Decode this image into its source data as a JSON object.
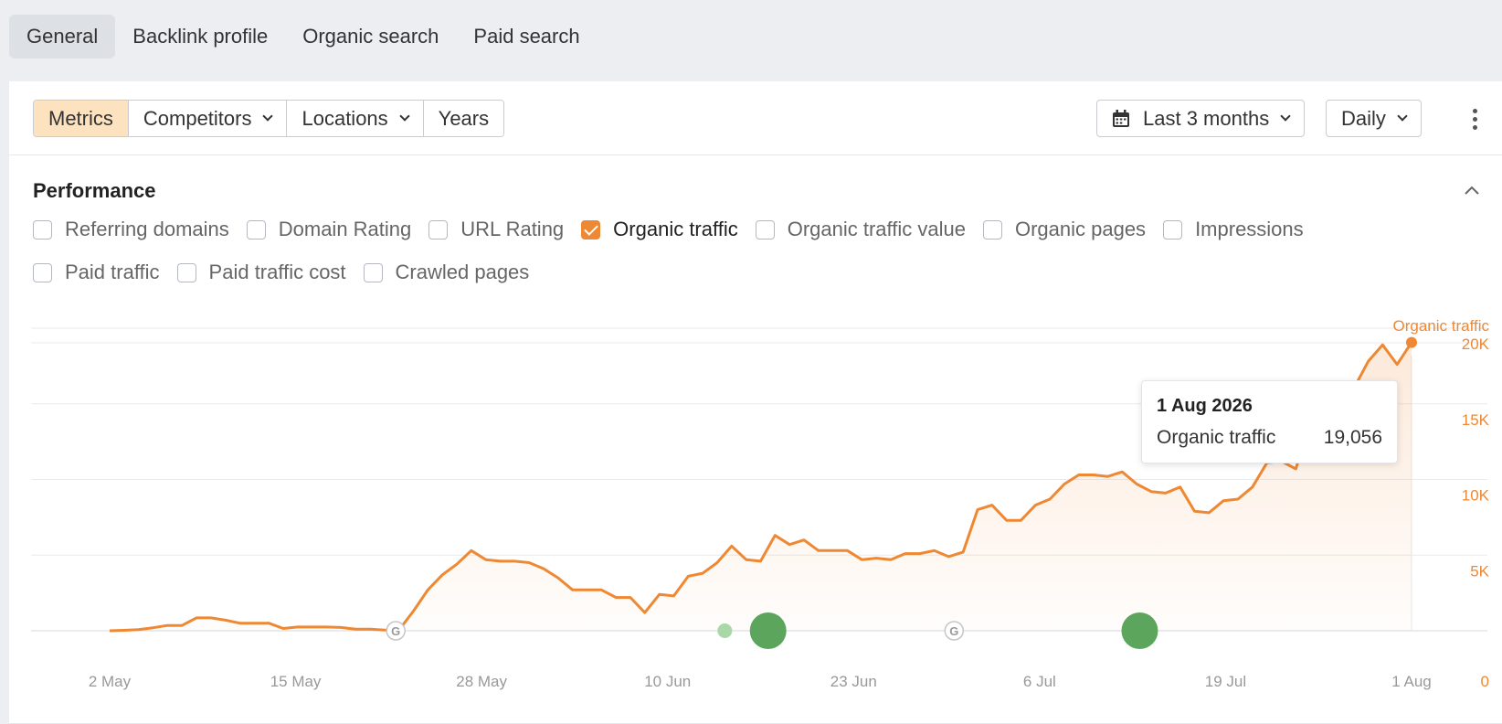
{
  "tabs": [
    "General",
    "Backlink profile",
    "Organic search",
    "Paid search"
  ],
  "toolbar": {
    "segments": [
      "Metrics",
      "Competitors",
      "Locations",
      "Years"
    ],
    "date_range": "Last 3 months",
    "interval": "Daily"
  },
  "performance": {
    "title": "Performance",
    "row1": [
      {
        "label": "Referring domains",
        "checked": false
      },
      {
        "label": "Domain Rating",
        "checked": false
      },
      {
        "label": "URL Rating",
        "checked": false
      },
      {
        "label": "Organic traffic",
        "checked": true
      },
      {
        "label": "Organic traffic value",
        "checked": false
      },
      {
        "label": "Organic pages",
        "checked": false
      },
      {
        "label": "Impressions",
        "checked": false
      }
    ],
    "row2": [
      {
        "label": "Paid traffic",
        "checked": false
      },
      {
        "label": "Paid traffic cost",
        "checked": false
      },
      {
        "label": "Crawled pages",
        "checked": false
      }
    ]
  },
  "tooltip": {
    "date": "1 Aug 2026",
    "metric": "Organic traffic",
    "value": "19,056"
  },
  "colors": {
    "accent": "#ee8833",
    "annotation_green": "#5ba55d"
  },
  "chart_data": {
    "type": "area",
    "series": [
      {
        "name": "Organic traffic",
        "values": [
          0,
          30,
          80,
          200,
          350,
          350,
          850,
          850,
          700,
          500,
          500,
          500,
          150,
          250,
          250,
          250,
          220,
          100,
          100,
          50,
          50,
          1300,
          2700,
          3700,
          4400,
          5300,
          4700,
          4600,
          4600,
          4500,
          4100,
          3500,
          2700,
          2700,
          2700,
          2200,
          2200,
          1200,
          2400,
          2300,
          3600,
          3800,
          4500,
          5600,
          4700,
          4600,
          6300,
          5700,
          6000,
          5300,
          5300,
          5300,
          4700,
          4800,
          4700,
          5100,
          5100,
          5300,
          4900,
          5200,
          8000,
          8300,
          7300,
          7300,
          8300,
          8700,
          9700,
          10300,
          10300,
          10200,
          10500,
          9700,
          9200,
          9100,
          9500,
          7900,
          7800,
          8600,
          8700,
          9500,
          11100,
          11200,
          10700,
          13700,
          14000,
          13000,
          16000,
          17800,
          18900,
          17600,
          19056
        ]
      }
    ],
    "x_tick_labels": [
      "2 May",
      "15 May",
      "28 May",
      "10 Jun",
      "23 Jun",
      "6 Jul",
      "19 Jul",
      "1 Aug"
    ],
    "y_tick_labels": [
      "0",
      "5K",
      "10K",
      "15K",
      "20K"
    ],
    "y_axis_title": "Organic traffic",
    "ylim": [
      0,
      20000
    ],
    "grid": true,
    "google_updates": [
      "22 May",
      "23 Jun"
    ],
    "annotations": [
      {
        "date": "10 Jun",
        "size": "large"
      },
      {
        "date": "14 Jun",
        "size": "small"
      },
      {
        "date": "13 Jul",
        "size": "large"
      }
    ]
  }
}
